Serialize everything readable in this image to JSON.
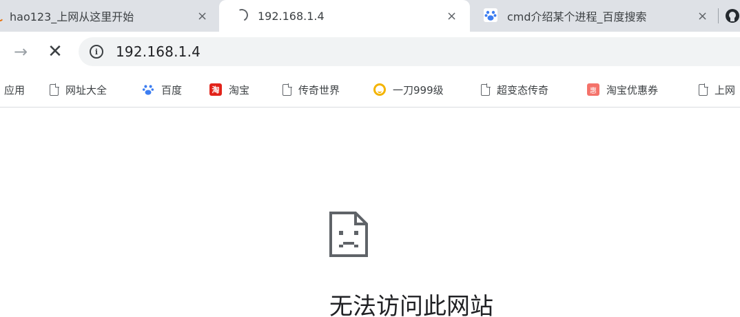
{
  "tabs": [
    {
      "title": "hao123_上网从这里开始",
      "close": "×"
    },
    {
      "title": "192.168.1.4",
      "close": "×",
      "active": true,
      "loading": true
    },
    {
      "title": "cmd介绍某个进程_百度搜索",
      "close": "×",
      "favicon": "baidu-paw-icon"
    }
  ],
  "toolbar": {
    "forward": "→",
    "stop": "✕",
    "info_glyph": "i",
    "url": "192.168.1.4"
  },
  "bookmarks": [
    {
      "label": "应用",
      "icon": "apps-icon"
    },
    {
      "label": "网址大全",
      "icon": "page-icon"
    },
    {
      "label": "百度",
      "icon": "baidu-paw-icon"
    },
    {
      "label": "淘宝",
      "icon": "taobao-icon",
      "glyph": "淘"
    },
    {
      "label": "传奇世界",
      "icon": "page-icon"
    },
    {
      "label": "一刀999级",
      "icon": "game-icon"
    },
    {
      "label": "超变态传奇",
      "icon": "page-icon"
    },
    {
      "label": "淘宝优惠券",
      "icon": "coupon-icon",
      "glyph": "惠"
    },
    {
      "label": "上网",
      "icon": "page-icon"
    }
  ],
  "error": {
    "title": "无法访问此网站"
  },
  "colors": {
    "tabstrip": "#dee1e6",
    "omnibox": "#f1f3f4",
    "taobao": "#e2231a",
    "baidu": "#3c7df1"
  }
}
